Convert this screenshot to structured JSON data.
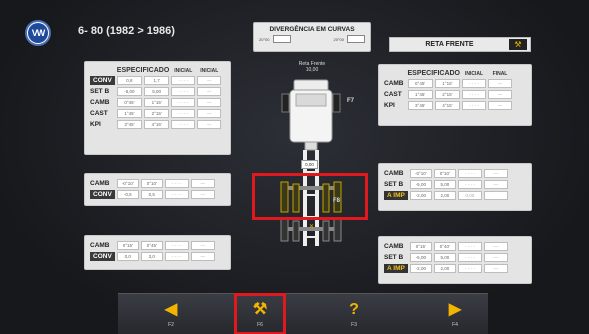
{
  "header": {
    "model": "6- 80  (1982 > 1986)"
  },
  "divergencia": {
    "title": "DIVERGÊNCIA EM CURVAS",
    "left_label": "20°00",
    "right_label": "20°00"
  },
  "reta_frente": {
    "label": "RETA FRENTE",
    "icon": "wrench-icon"
  },
  "truck": {
    "top_label": "Reta Frente",
    "top_value": "10,00",
    "f7": "F7",
    "f8": "F8",
    "axle_value": "0,00"
  },
  "panel_left_1": {
    "headers": [
      "ESPECIFICADO",
      "INICIAL",
      "INICIAL"
    ],
    "rows": [
      {
        "label": "CONV",
        "dark": true,
        "v1": "0,8",
        "v2": "1,7",
        "v3": "- - - -",
        "v4": "—"
      },
      {
        "label": "SET B",
        "dark": false,
        "v1": "-5,00",
        "v2": "5,00",
        "v3": "- - - -",
        "v4": "—"
      },
      {
        "label": "CAMB",
        "dark": false,
        "v1": "0°45'",
        "v2": "1°15'",
        "v3": "- - - -",
        "v4": "—"
      },
      {
        "label": "CAST",
        "dark": false,
        "v1": "1°45'",
        "v2": "2°15'",
        "v3": "- - - -",
        "v4": "—"
      },
      {
        "label": "KPI",
        "dark": false,
        "v1": "3°45'",
        "v2": "4°15'",
        "v3": "- - - -",
        "v4": "—"
      }
    ]
  },
  "panel_right_1": {
    "headers": [
      "ESPECIFICADO",
      "INICIAL",
      "FINAL"
    ],
    "rows": [
      {
        "label": "CAMB",
        "v1": "0°45'",
        "v2": "1°15'",
        "v3": "- - - -",
        "v4": "—"
      },
      {
        "label": "CAST",
        "v1": "1°45'",
        "v2": "2°15'",
        "v3": "- - - -",
        "v4": "—"
      },
      {
        "label": "KPI",
        "v1": "3°45'",
        "v2": "4°15'",
        "v3": "- - - -",
        "v4": "—"
      }
    ]
  },
  "panel_left_2": {
    "rows": [
      {
        "label": "CAMB",
        "dark": false,
        "v1": "-0°10'",
        "v2": "0°10'",
        "v3": "- - - -",
        "v4": "—"
      },
      {
        "label": "CONV",
        "dark": true,
        "v1": "-0,5",
        "v2": "0,5",
        "v3": "- - - -",
        "v4": "—"
      }
    ]
  },
  "panel_right_2": {
    "rows": [
      {
        "label": "CAMB",
        "style": "plain",
        "v1": "-0°10'",
        "v2": "0°10'",
        "v3": "- - - -",
        "v4": "—"
      },
      {
        "label": "SET B",
        "style": "plain",
        "v1": "-5,00",
        "v2": "5,00",
        "v3": "- - - -",
        "v4": "—"
      },
      {
        "label": "A IMP",
        "style": "gold",
        "v1": "-2,00",
        "v2": "2,00",
        "v3": "0,00",
        "v4": ""
      }
    ]
  },
  "panel_left_3": {
    "rows": [
      {
        "label": "CAMB",
        "dark": false,
        "v1": "0°15'",
        "v2": "0°45'",
        "v3": "- - - -",
        "v4": "—"
      },
      {
        "label": "CONV",
        "dark": true,
        "v1": "0,0",
        "v2": "3,0",
        "v3": "- - - -",
        "v4": "—"
      }
    ]
  },
  "panel_right_3": {
    "rows": [
      {
        "label": "CAMB",
        "style": "plain",
        "v1": "0°15'",
        "v2": "0°40'",
        "v3": "- - - -",
        "v4": "—"
      },
      {
        "label": "SET B",
        "style": "plain",
        "v1": "-5,00",
        "v2": "5,00",
        "v3": "- - - -",
        "v4": "—"
      },
      {
        "label": "A IMP",
        "style": "gold",
        "v1": "-2,00",
        "v2": "2,00",
        "v3": "- - - -",
        "v4": "—"
      }
    ]
  },
  "nav": [
    {
      "name": "prev-button",
      "glyph": "◀",
      "key": "F2"
    },
    {
      "name": "adjust-button",
      "glyph": "⚒",
      "key": "F6"
    },
    {
      "name": "help-button",
      "glyph": "?",
      "key": "F3"
    },
    {
      "name": "next-button",
      "glyph": "▶",
      "key": "F4"
    }
  ],
  "colors": {
    "accent": "#f3b400",
    "highlight": "#e0191f",
    "panel": "#e4e4e4"
  }
}
